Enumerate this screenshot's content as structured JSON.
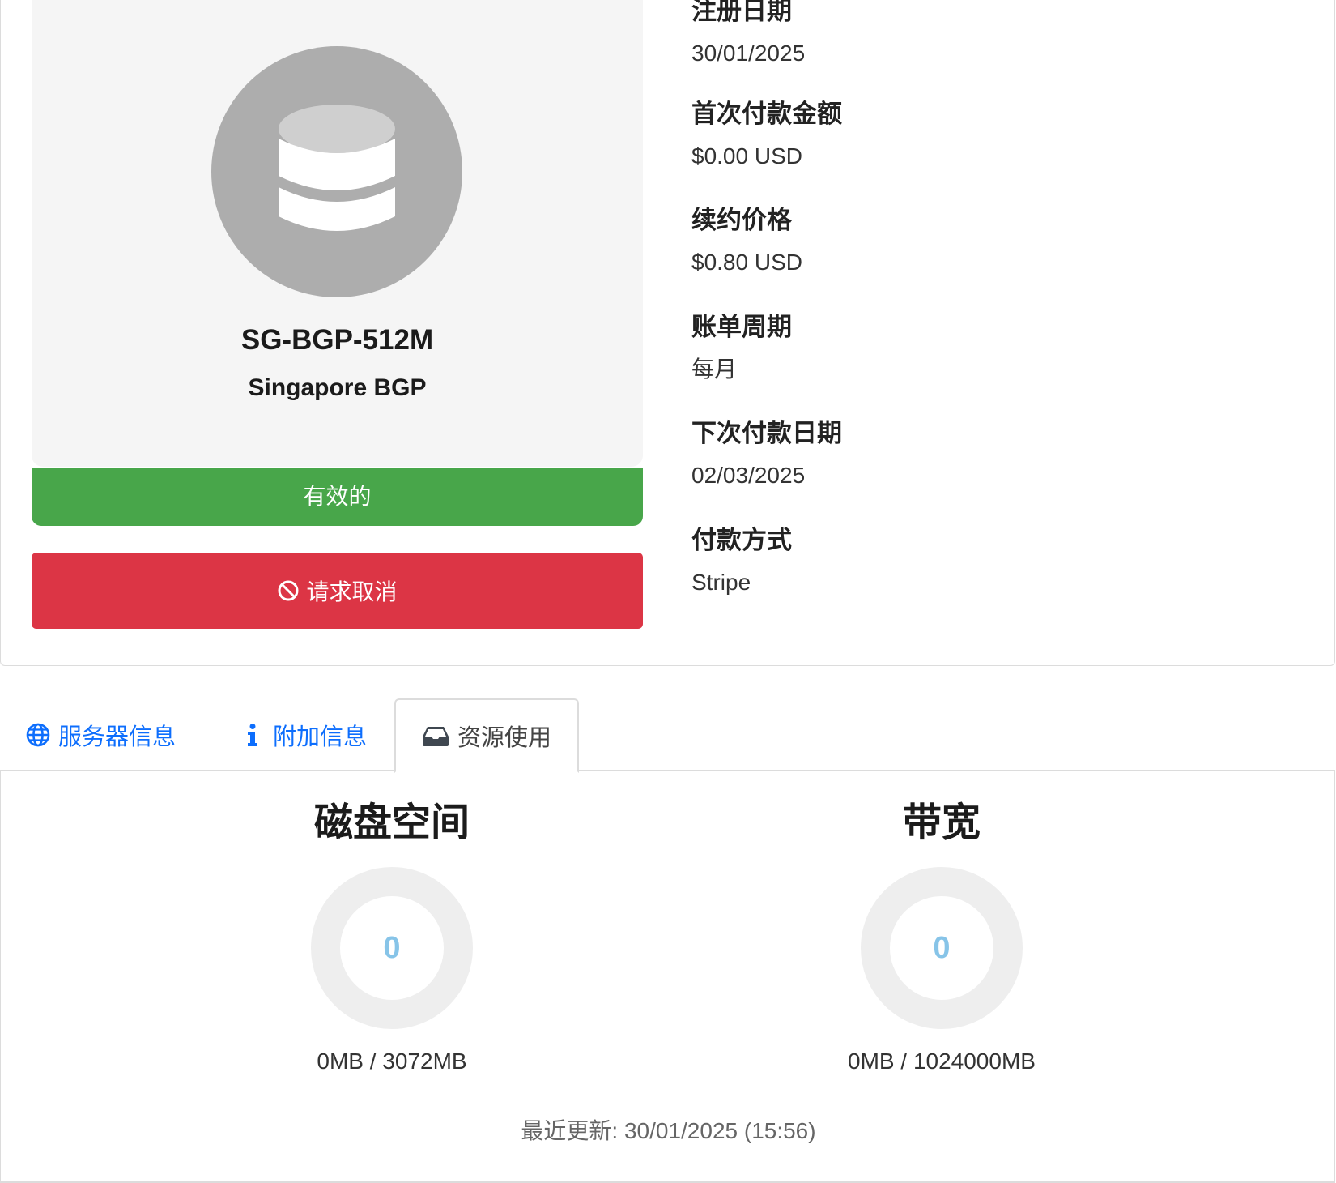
{
  "product": {
    "name": "SG-BGP-512M",
    "group": "Singapore BGP",
    "icon": "database-icon",
    "status": "有效的",
    "status_color": "#48a64a",
    "cancel_label": "请求取消",
    "cancel_color": "#dc3545"
  },
  "billing": [
    {
      "label": "注册日期",
      "value": "30/01/2025"
    },
    {
      "label": "首次付款金额",
      "value": "$0.00 USD"
    },
    {
      "label": "续约价格",
      "value": "$0.80 USD"
    },
    {
      "label": "账单周期",
      "value": "每月"
    },
    {
      "label": "下次付款日期",
      "value": "02/03/2025"
    },
    {
      "label": "付款方式",
      "value": "Stripe"
    }
  ],
  "tabs": [
    {
      "label": "服务器信息",
      "icon": "globe-icon",
      "active": false
    },
    {
      "label": "附加信息",
      "icon": "info-icon",
      "active": false
    },
    {
      "label": "资源使用",
      "icon": "inbox-icon",
      "active": true
    }
  ],
  "usage": {
    "disk": {
      "title": "磁盘空间",
      "value": "0",
      "text": "0MB / 3072MB",
      "percent": 0
    },
    "bandwidth": {
      "title": "带宽",
      "value": "0",
      "text": "0MB / 1024000MB",
      "percent": 0
    },
    "last_updated": "最近更新: 30/01/2025 (15:56)"
  },
  "colors": {
    "link": "#0d6efd",
    "gauge_track": "#eeeeee",
    "gauge_value": "#87c4e8"
  }
}
